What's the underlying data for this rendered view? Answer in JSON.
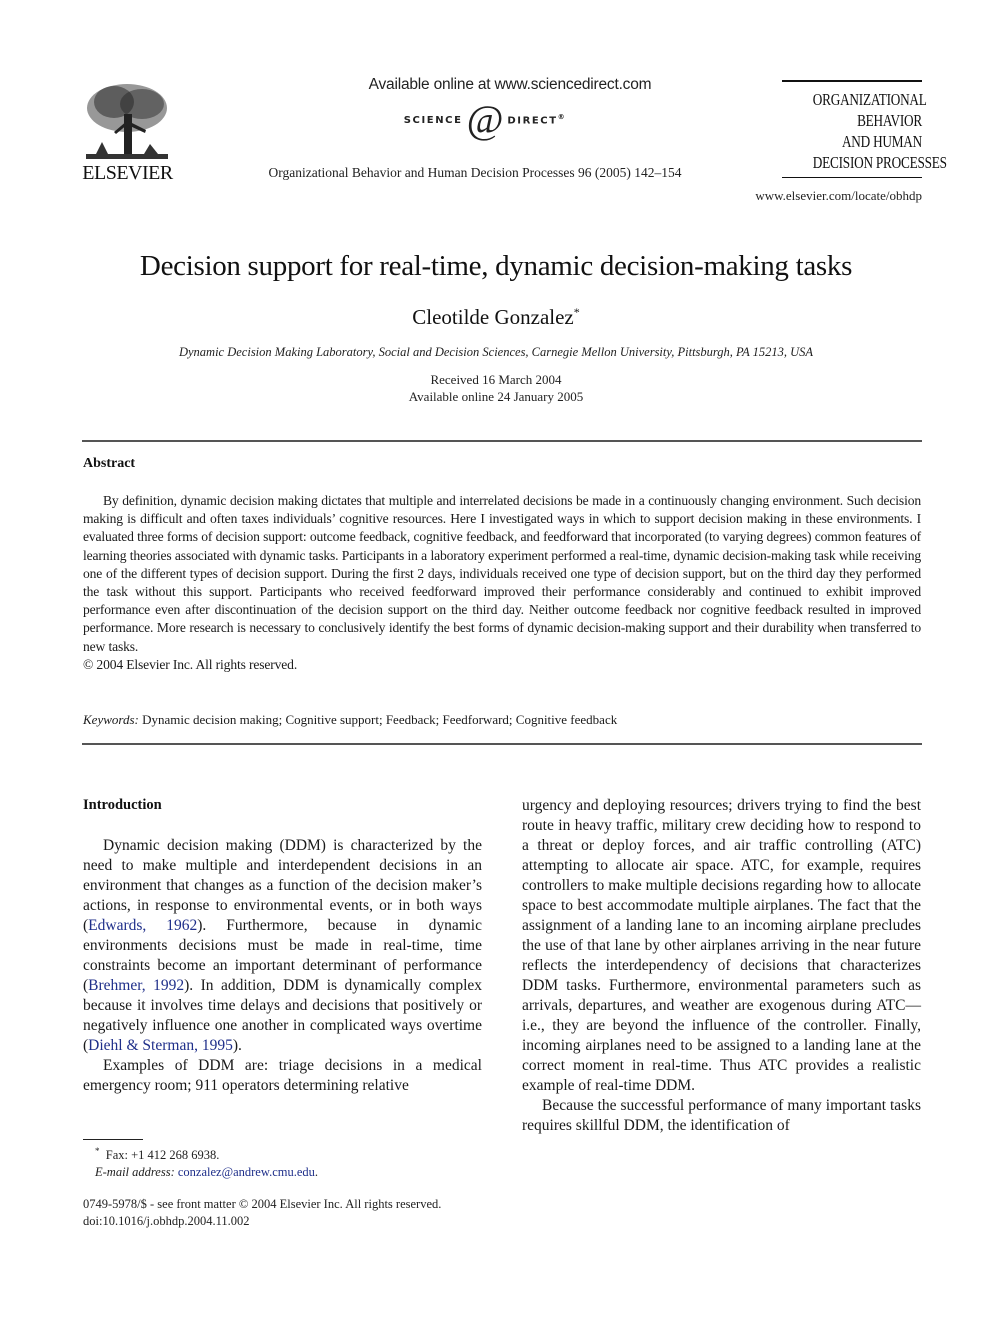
{
  "header": {
    "publisher_logo_text": "ELSEVIER",
    "available_online": "Available online at www.sciencedirect.com",
    "sciencedirect_left": "SCIENCE",
    "sciencedirect_at": "d",
    "sciencedirect_right": "DIRECT",
    "sciencedirect_reg": "®",
    "journal_citation": "Organizational Behavior and Human Decision Processes 96 (2005) 142–154",
    "journal_logo_lines": [
      "ORGANIZATIONAL",
      "BEHAVIOR",
      "AND HUMAN",
      "DECISION PROCESSES"
    ],
    "journal_url": "www.elsevier.com/locate/obhdp"
  },
  "article": {
    "title": "Decision support for real-time, dynamic decision-making tasks",
    "author": "Cleotilde Gonzalez",
    "author_mark": "*",
    "affiliation": "Dynamic Decision Making Laboratory, Social and Decision Sciences, Carnegie Mellon University, Pittsburgh, PA 15213, USA",
    "received": "Received 16 March 2004",
    "available_online": "Available online 24 January 2005"
  },
  "abstract": {
    "heading": "Abstract",
    "text": "By definition, dynamic decision making dictates that multiple and interrelated decisions be made in a continuously changing environment. Such decision making is difficult and often taxes individuals’ cognitive resources. Here I investigated ways in which to support decision making in these environments. I evaluated three forms of decision support: outcome feedback, cognitive feedback, and feedforward that incorporated (to varying degrees) common features of learning theories associated with dynamic tasks. Participants in a laboratory experiment performed a real-time, dynamic decision-making task while receiving one of the different types of decision support. During the first 2 days, individuals received one type of decision support, but on the third day they performed the task without this support. Participants who received feedforward improved their performance considerably and continued to exhibit improved performance even after discontinuation of the decision support on the third day. Neither outcome feedback nor cognitive feedback resulted in improved performance. More research is necessary to conclusively identify the best forms of dynamic decision-making support and their durability when transferred to new tasks.",
    "copyright": "© 2004 Elsevier Inc. All rights reserved.",
    "keywords_label": "Keywords:",
    "keywords": "Dynamic decision making; Cognitive support; Feedback; Feedforward; Cognitive feedback"
  },
  "introduction": {
    "heading": "Introduction",
    "p1_a": "Dynamic decision making (DDM) is characterized by the need to make multiple and interdependent decisions in an environment that changes as a function of the decision maker’s actions, in response to environmental events, or in both ways (",
    "p1_cite1": "Edwards, 1962",
    "p1_b": "). Furthermore, because in dynamic environments decisions must be made in real-time, time constraints become an important determinant of performance (",
    "p1_cite2": "Brehmer, 1992",
    "p1_c": "). In addition, DDM is dynamically complex because it involves time delays and decisions that positively or negatively influence one another in complicated ways overtime (",
    "p1_cite3": "Diehl & Sterman, 1995",
    "p1_d": ").",
    "p2_left": "Examples of DDM are: triage decisions in a medical emergency room; 911 operators determining relative",
    "p2_right": "urgency and deploying resources; drivers trying to find the best route in heavy traffic, military crew deciding how to respond to a threat or deploy forces, and air traffic controlling (ATC) attempting to allocate air space. ATC, for example, requires controllers to make multiple decisions regarding how to allocate space to best accommodate multiple airplanes. The fact that the assignment of a landing lane to an incoming airplane precludes the use of that lane by other airplanes arriving in the near future reflects the interdependency of decisions that characterizes DDM tasks. Furthermore, environmental parameters such as arrivals, departures, and weather are exogenous during ATC—i.e., they are beyond the influence of the controller. Finally, incoming airplanes need to be assigned to a landing lane at the correct moment in real-time. Thus ATC provides a realistic example of real-time DDM.",
    "p3": "Because the successful performance of many important tasks requires skillful DDM, the identification of"
  },
  "footnotes": {
    "mark": "*",
    "fax": "Fax: +1 412 268 6938.",
    "email_label": "E-mail address:",
    "email": "conzalez@andrew.cmu.edu",
    "email_end": "."
  },
  "front_matter": {
    "issn_line": "0749-5978/$ - see front matter © 2004 Elsevier Inc. All rights reserved.",
    "doi": "doi:10.1016/j.obhdp.2004.11.002"
  },
  "colors": {
    "link": "#1f2f8a",
    "text": "#1a1a1a"
  }
}
